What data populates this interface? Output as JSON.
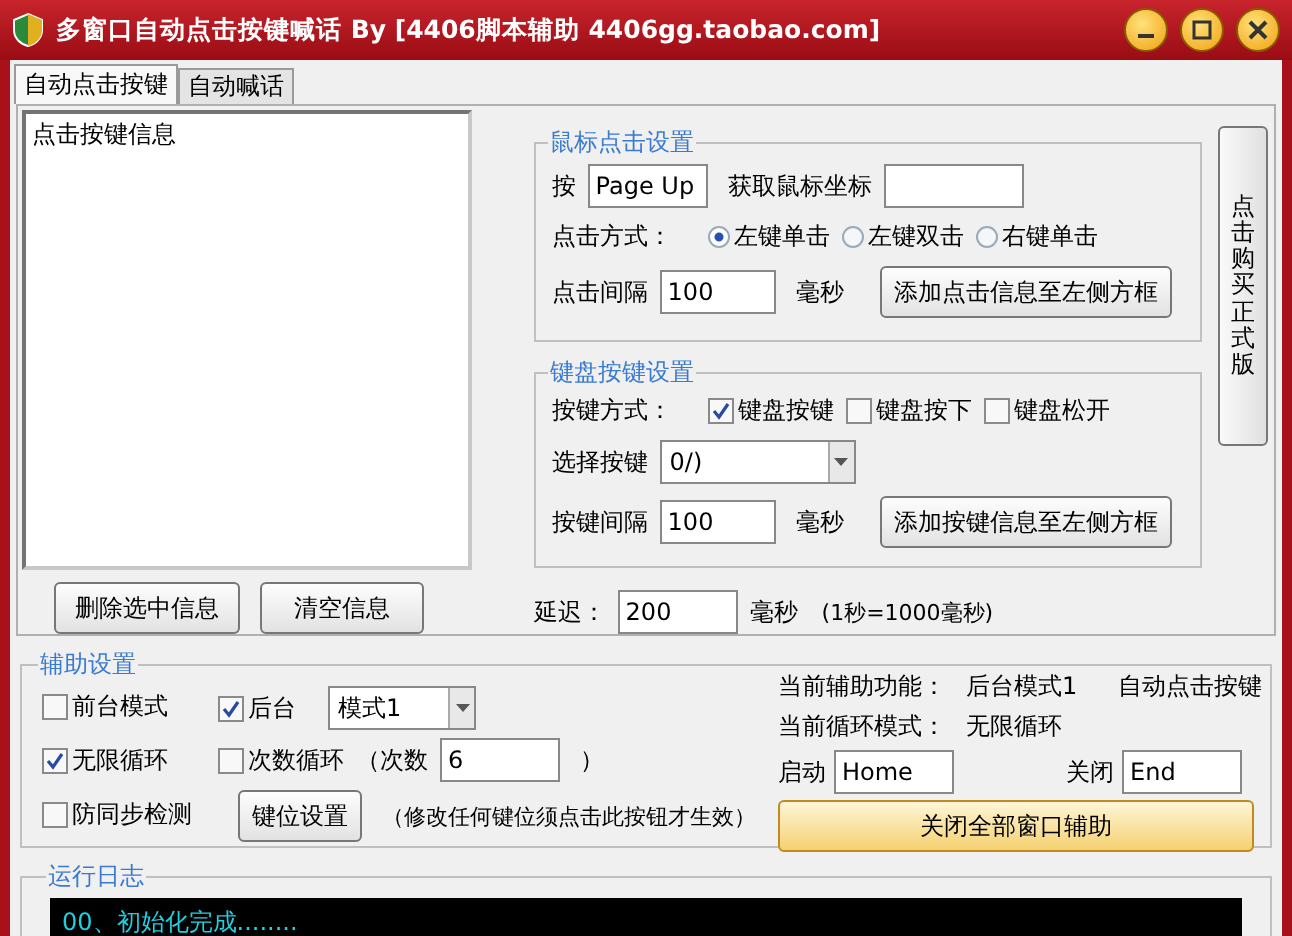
{
  "window": {
    "title": "多窗口自动点击按键喊话 By [4406脚本辅助 4406gg.taobao.com]"
  },
  "tabs": [
    {
      "label": "自动点击按键",
      "selected": true
    },
    {
      "label": "自动喊话",
      "selected": false
    }
  ],
  "list": {
    "header": "点击按键信息"
  },
  "mouse_group": {
    "title": "鼠标点击设置",
    "key_label": "按",
    "key_value": "Page Up",
    "coord_label": "获取鼠标坐标",
    "mode_label": "点击方式：",
    "modes": [
      {
        "label": "左键单击",
        "selected": true
      },
      {
        "label": "左键双击",
        "selected": false
      },
      {
        "label": "右键单击",
        "selected": false
      }
    ],
    "interval_label": "点击间隔",
    "interval_value": "100",
    "unit": "毫秒",
    "add_button": "添加点击信息至左侧方框"
  },
  "keyboard_group": {
    "title": "键盘按键设置",
    "mode_label": "按键方式：",
    "modes": [
      {
        "label": "键盘按键",
        "checked": true
      },
      {
        "label": "键盘按下",
        "checked": false
      },
      {
        "label": "键盘松开",
        "checked": false
      }
    ],
    "select_label": "选择按键",
    "select_value": "0/)",
    "interval_label": "按键间隔",
    "interval_value": "100",
    "unit": "毫秒",
    "add_button": "添加按键信息至左侧方框"
  },
  "buy_button": "点击购买正式版",
  "delete_button": "删除选中信息",
  "clear_button": "清空信息",
  "delay": {
    "label": "延迟：",
    "value": "200",
    "unit": "毫秒",
    "note": "(1秒=1000毫秒)"
  },
  "assist": {
    "title": "辅助设置",
    "foreground": {
      "label": "前台模式",
      "checked": false
    },
    "background": {
      "label": "后台",
      "checked": true
    },
    "mode_select": "模式1",
    "infinite": {
      "label": "无限循环",
      "checked": true
    },
    "count_loop": {
      "label": "次数循环",
      "checked": false
    },
    "count_label": "（次数",
    "count_value": "6",
    "count_close": "）",
    "anti_sync": {
      "label": "防同步检测",
      "checked": false
    },
    "keys_button": "键位设置",
    "keys_note": "（修改任何键位须点击此按钮才生效）",
    "current_func_label": "当前辅助功能：",
    "current_func_mode": "后台模式1",
    "current_func_name": "自动点击按键",
    "current_loop_label": "当前循环模式：",
    "current_loop_value": "无限循环",
    "start_label": "启动",
    "start_value": "Home",
    "stop_label": "关闭",
    "stop_value": "End",
    "close_all_button": "关闭全部窗口辅助"
  },
  "log": {
    "title": "运行日志",
    "lines": [
      "00、初始化完成........"
    ]
  }
}
